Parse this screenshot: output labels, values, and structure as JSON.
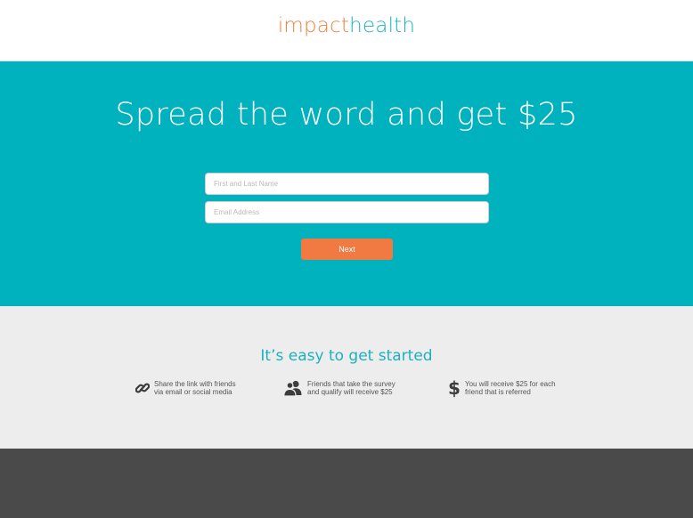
{
  "brand": {
    "part1": "impact",
    "part2": "health",
    "color1": "#f08040",
    "color2": "#1bb1bf"
  },
  "hero": {
    "title": "Spread the word and get $25",
    "name_placeholder": "First and Last Name",
    "email_placeholder": "Email Address",
    "next_label": "Next",
    "background": "#00b1be",
    "button_color": "#f07a42"
  },
  "steps": {
    "title": "It’s easy to get started",
    "items": [
      {
        "icon": "link-icon",
        "line1": "Share the link with friends",
        "line2": "via email or social media"
      },
      {
        "icon": "users-icon",
        "line1": "Friends that take the survey",
        "line2": "and qualify will receive $25"
      },
      {
        "icon": "dollar-icon",
        "glyph": "$",
        "line1": "You will receive $25 for each",
        "line2": "friend that is referred"
      }
    ]
  }
}
